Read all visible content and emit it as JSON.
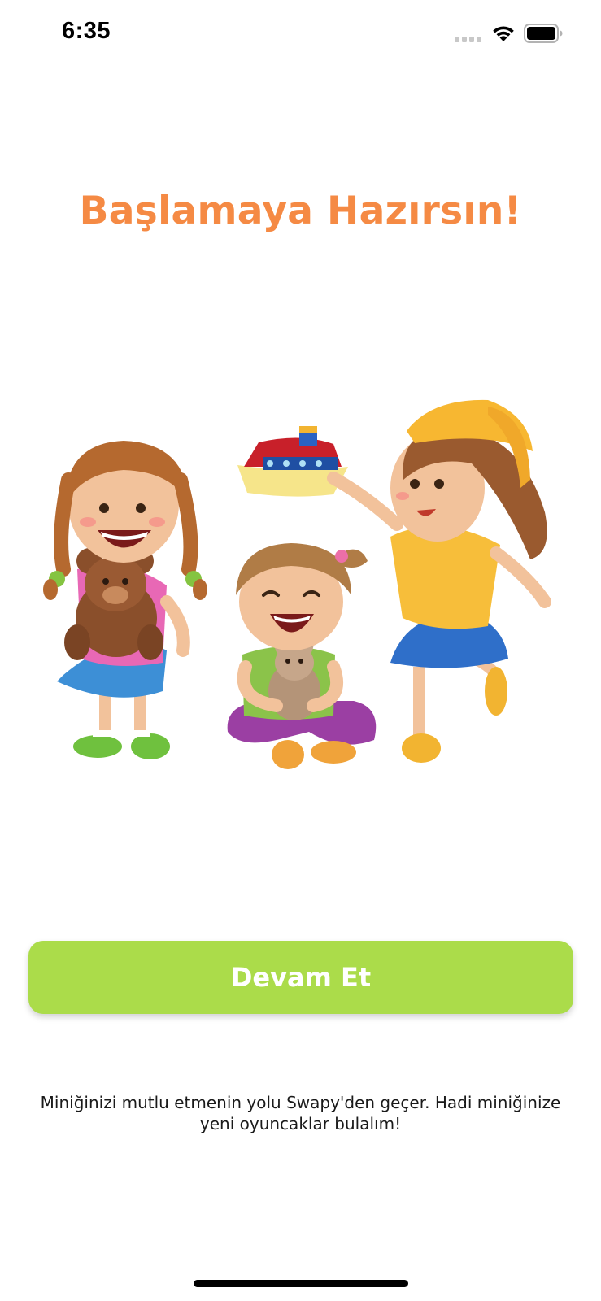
{
  "status_bar": {
    "time": "6:35",
    "icons": [
      "signal-icon",
      "wifi-icon",
      "battery-icon"
    ]
  },
  "welcome": {
    "headline": "Başlamaya Hazırsın!",
    "illustration": "kids-playing-with-toys-illustration",
    "continue_label": "Devam Et",
    "footer_line1": "Miniğinizi mutlu etmenin yolu Swapy'den geçer. Hadi miniğinize",
    "footer_line2": "yeni oyuncaklar bulalım!"
  },
  "colors": {
    "headline": "#f58a44",
    "button_bg": "#abdc4a",
    "button_text": "#ffffff",
    "background": "#ffffff"
  }
}
